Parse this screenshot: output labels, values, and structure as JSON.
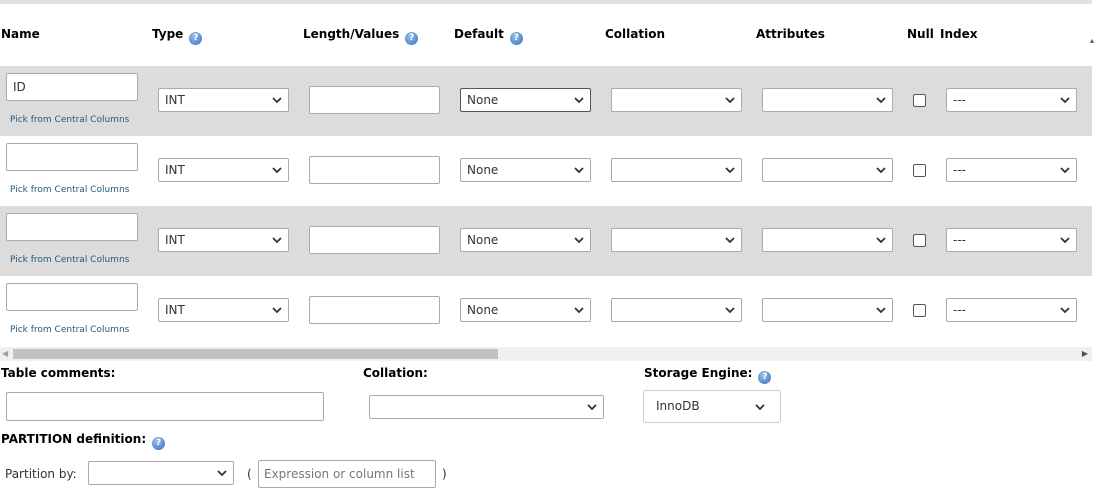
{
  "columns": {
    "name": "Name",
    "type": "Type",
    "length_values": "Length/Values",
    "default": "Default",
    "collation": "Collation",
    "attributes": "Attributes",
    "null": "Null",
    "index": "Index"
  },
  "rows": [
    {
      "name": "ID",
      "pick": "Pick from Central Columns",
      "type": "INT",
      "length": "",
      "default": "None",
      "collation": "",
      "attributes": "",
      "null": false,
      "index": "---"
    },
    {
      "name": "",
      "pick": "Pick from Central Columns",
      "type": "INT",
      "length": "",
      "default": "None",
      "collation": "",
      "attributes": "",
      "null": false,
      "index": "---"
    },
    {
      "name": "",
      "pick": "Pick from Central Columns",
      "type": "INT",
      "length": "",
      "default": "None",
      "collation": "",
      "attributes": "",
      "null": false,
      "index": "---"
    },
    {
      "name": "",
      "pick": "Pick from Central Columns",
      "type": "INT",
      "length": "",
      "default": "None",
      "collation": "",
      "attributes": "",
      "null": false,
      "index": "---"
    }
  ],
  "table_options": {
    "comments_label": "Table comments:",
    "collation_label": "Collation:",
    "collation_value": "",
    "engine_label": "Storage Engine:",
    "engine_value": "InnoDB"
  },
  "partition": {
    "title": "PARTITION definition:",
    "by_label": "Partition by:",
    "by_value": "",
    "open_paren": "(",
    "expression_placeholder": "Expression or column list",
    "close_paren": ")"
  },
  "help_glyph": "?",
  "icons": [
    "help-icon",
    "chevron-down-icon",
    "scroll-left-icon",
    "scroll-right-icon"
  ],
  "colors": {
    "row_shade": "#dcdcdc",
    "link": "#235a81",
    "help_icon": "#4f86c9",
    "scroll_thumb": "#c2c2c2"
  }
}
